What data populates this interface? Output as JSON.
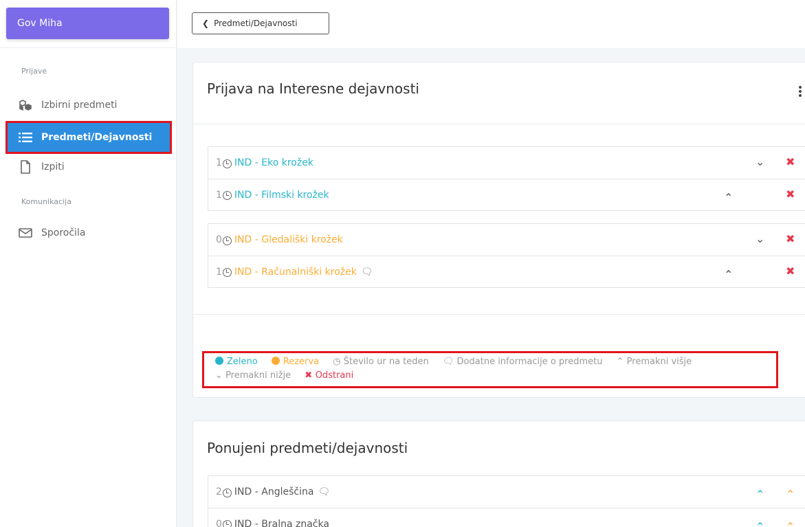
{
  "colors": {
    "accent": "#7b6be8",
    "active": "#2d8ee0",
    "teal": "#26b6cc",
    "orange": "#fbac35",
    "remove": "#e8384f",
    "highlight": "#e1141c"
  },
  "user": {
    "name": "Gov Miha"
  },
  "sidebar": {
    "section_prijave": "Prijave",
    "section_komunikacija": "Komunikacija",
    "items": [
      {
        "label": "Izbirni predmeti",
        "icon": "cubes-icon"
      },
      {
        "label": "Predmeti/Dejavnosti",
        "icon": "list-icon",
        "active": true
      },
      {
        "label": "Izpiti",
        "icon": "file-icon"
      },
      {
        "label": "Sporočila",
        "icon": "envelope-icon"
      }
    ]
  },
  "back_button": {
    "label": "Predmeti/Dejavnosti"
  },
  "signup_card": {
    "title": "Prijava na Interesne dejavnosti",
    "groups": [
      [
        {
          "hours": "1",
          "name": "IND - Eko krožek",
          "status": "teal"
        },
        {
          "hours": "1",
          "name": "IND - Filmski krožek",
          "status": "teal"
        }
      ],
      [
        {
          "hours": "0",
          "name": "IND - Gledališki krožek",
          "status": "orange"
        },
        {
          "hours": "1",
          "name": "IND - Računalniški krožek",
          "status": "orange",
          "comment": true
        }
      ]
    ]
  },
  "legend": {
    "green": "Zeleno",
    "reserve": "Rezerva",
    "hours": "Število ur na teden",
    "info": "Dodatne informacije o predmetu",
    "up": "Premakni višje",
    "down": "Premakni nižje",
    "remove": "Odstrani"
  },
  "offered_card": {
    "title": "Ponujeni predmeti/dejavnosti",
    "rows": [
      {
        "hours": "2",
        "name": "IND - Angleščina",
        "comment": true
      },
      {
        "hours": "0",
        "name": "IND - Bralna značka"
      }
    ]
  }
}
